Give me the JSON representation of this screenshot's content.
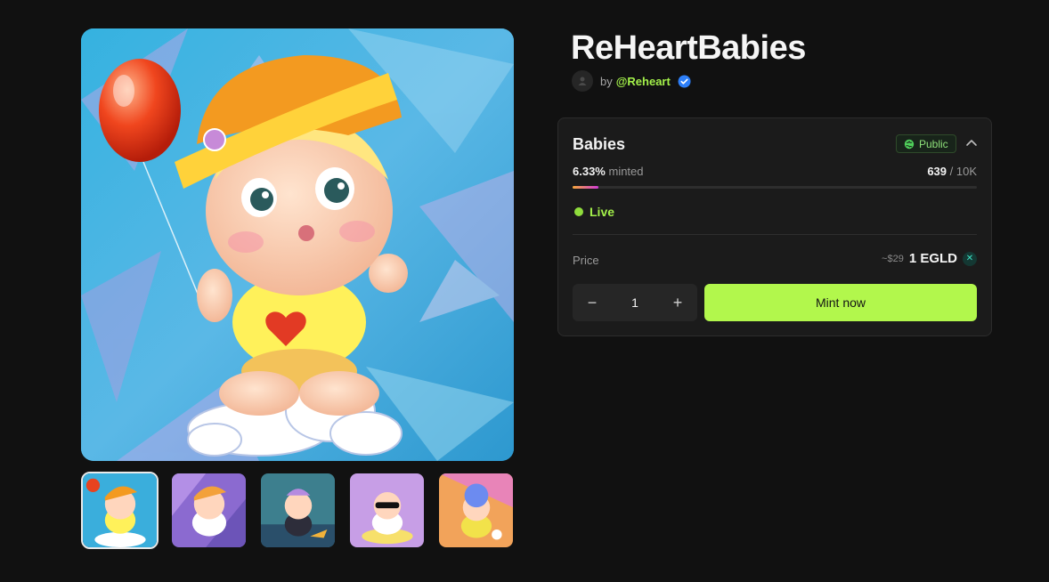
{
  "collection": {
    "title": "ReHeartBabies",
    "by_label": "by",
    "creator_handle": "@Reheart"
  },
  "media": {
    "thumbnails": [
      {
        "name": "thumb-1",
        "active": true
      },
      {
        "name": "thumb-2",
        "active": false
      },
      {
        "name": "thumb-3",
        "active": false
      },
      {
        "name": "thumb-4",
        "active": false
      },
      {
        "name": "thumb-5",
        "active": false
      }
    ]
  },
  "stage": {
    "name": "Babies",
    "visibility": "Public",
    "minted_percent_label": "6.33%",
    "minted_word": " minted",
    "minted_count": "639",
    "supply_sep": " / ",
    "total_supply": "10K",
    "progress_fraction": 0.0633,
    "status": "Live",
    "price_label": "Price",
    "price_usd": "~$29",
    "price_egld": "1 EGLD",
    "quantity": "1",
    "decrement_label": "−",
    "increment_label": "+",
    "mint_label": "Mint now"
  },
  "colors": {
    "accent_green": "#b2f74c",
    "live_green": "#8fdc3c",
    "background": "#111111",
    "card": "#1b1b1b"
  }
}
